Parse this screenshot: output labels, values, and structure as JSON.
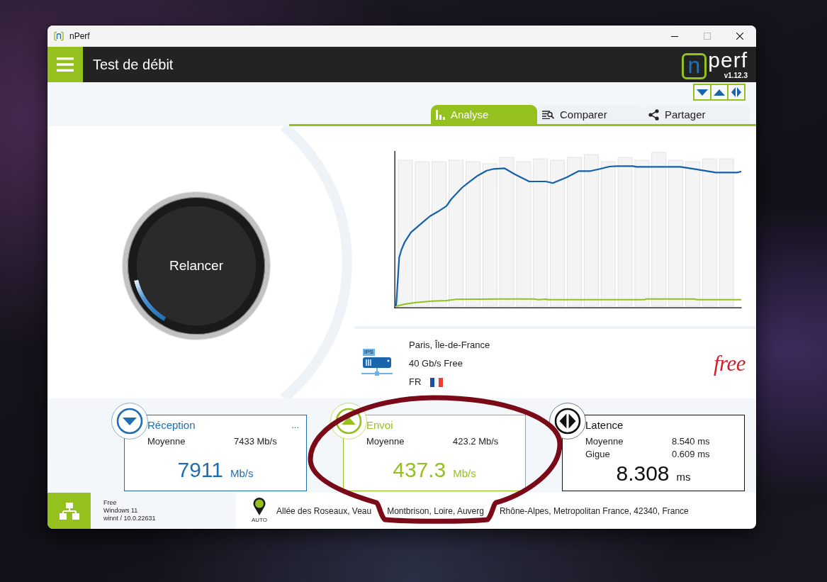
{
  "window": {
    "title": "nPerf"
  },
  "header": {
    "title": "Test de débit",
    "logo": {
      "letter": "n",
      "word": "perf",
      "version": "v1.12.3"
    }
  },
  "tabs": [
    {
      "label": "Analyse",
      "selected": true
    },
    {
      "label": "Comparer",
      "selected": false
    },
    {
      "label": "Partager",
      "selected": false
    }
  ],
  "restart_button": {
    "label": "Relancer"
  },
  "server": {
    "tag": "IPS",
    "location": "Paris, Île-de-France",
    "capacity": "40 Gb/s Free",
    "country": "FR",
    "isp": "free"
  },
  "results": [
    {
      "kind": "download",
      "title": "Réception",
      "more": "...",
      "color": "#1f6db3",
      "stats": [
        {
          "label": "Moyenne",
          "value": "7433 Mb/s"
        }
      ],
      "value": "7911",
      "unit": "Mb/s"
    },
    {
      "kind": "upload",
      "title": "Envoi",
      "color": "#95c11f",
      "stats": [
        {
          "label": "Moyenne",
          "value": "423.2 Mb/s"
        }
      ],
      "value": "437.3",
      "unit": "Mb/s"
    },
    {
      "kind": "latency",
      "title": "Latence",
      "color": "#111111",
      "stats": [
        {
          "label": "Moyenne",
          "value": "8.540 ms"
        },
        {
          "label": "Gigue",
          "value": "0.609 ms"
        }
      ],
      "value": "8.308",
      "unit": "ms"
    }
  ],
  "footer": {
    "connection": [
      "Free",
      "Windows 11",
      "winnt / 10.0.22631"
    ],
    "mode": "AUTO",
    "address_parts": [
      "Allée des Roseaux, Veau",
      "Montbrison, Loire, Auverg",
      "Rhône-Alpes, Metropolitan France, 42340, France"
    ]
  }
}
